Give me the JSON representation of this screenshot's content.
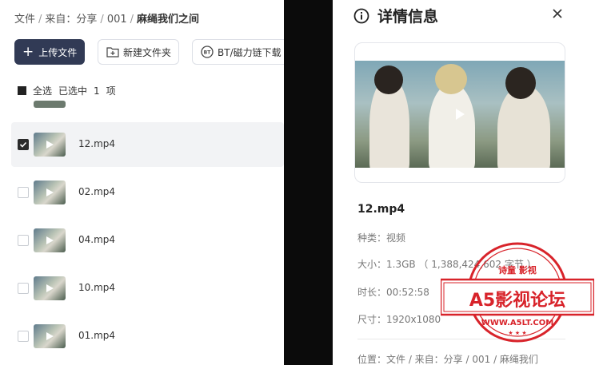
{
  "breadcrumb": {
    "items": [
      "文件",
      "来自：分享",
      "001"
    ],
    "separator": "/",
    "current": "麻绳我们之间"
  },
  "toolbar": {
    "upload_label": "上传文件",
    "new_folder_label": "新建文件夹",
    "bt_label": "BT/磁力链下载"
  },
  "selection": {
    "select_all": "全选",
    "selected_prefix": "已选中",
    "count": "1",
    "unit": "项"
  },
  "files": [
    {
      "name": "12.mp4",
      "selected": true
    },
    {
      "name": "02.mp4",
      "selected": false
    },
    {
      "name": "04.mp4",
      "selected": false
    },
    {
      "name": "10.mp4",
      "selected": false
    },
    {
      "name": "01.mp4",
      "selected": false
    }
  ],
  "details": {
    "title": "详情信息",
    "file_name": "12.mp4",
    "type": "种类：视频",
    "size": "大小：1.3GB （ 1,388,424,602 字节 ）",
    "duration": "时长：00:52:58",
    "dimensions": "尺寸：1920x1080",
    "location": "位置：文件 / 来自：分享 / 001 / 麻绳我们"
  },
  "watermark": {
    "top_text": "诗童 影视",
    "main_text": "A5影视论坛",
    "url": "WWW.A5LT.COM"
  },
  "colors": {
    "primary_button": "#313a55",
    "watermark_red": "#d8232a"
  },
  "icons": {
    "info": "info-circle-icon",
    "close": "close-icon",
    "upload": "plus-icon",
    "new_folder": "folder-plus-icon",
    "bt": "bt-icon"
  }
}
